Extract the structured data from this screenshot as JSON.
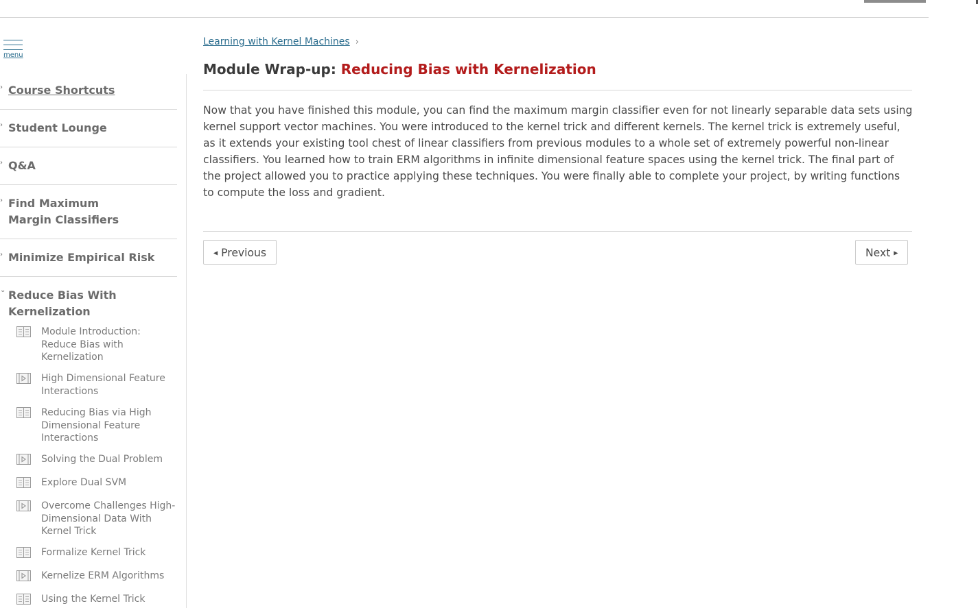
{
  "menu": {
    "label": "menu"
  },
  "sidebar": {
    "items": [
      {
        "label": "Course Shortcuts",
        "chevron": "›"
      },
      {
        "label": "Student Lounge",
        "chevron": "›"
      },
      {
        "label": "Q&A",
        "chevron": "›"
      },
      {
        "label": "Find Maximum Margin Classifiers",
        "chevron": "›"
      },
      {
        "label": "Minimize Empirical Risk",
        "chevron": "›"
      },
      {
        "label": "Reduce Bias With Kernelization",
        "chevron": "⌄"
      }
    ],
    "subitems": [
      {
        "label": "Module Introduction: Reduce Bias with Kernelization",
        "icon": "page-icon"
      },
      {
        "label": "High Dimensional Feature Interactions",
        "icon": "video-icon"
      },
      {
        "label": "Reducing Bias via High Dimensional Feature Interactions",
        "icon": "page-icon"
      },
      {
        "label": "Solving the Dual Problem",
        "icon": "video-icon"
      },
      {
        "label": "Explore Dual SVM",
        "icon": "page-icon"
      },
      {
        "label": "Overcome Challenges High-Dimensional Data With Kernel Trick",
        "icon": "video-icon"
      },
      {
        "label": "Formalize Kernel Trick",
        "icon": "page-icon"
      },
      {
        "label": "Kernelize ERM Algorithms",
        "icon": "video-icon"
      },
      {
        "label": "Using the Kernel Trick",
        "icon": "page-icon"
      }
    ]
  },
  "breadcrumb": {
    "link": "Learning with Kernel Machines",
    "separator": "›"
  },
  "page": {
    "title_prefix": "Module Wrap-up: ",
    "title_accent": "Reducing Bias with Kernelization",
    "body": "Now that you have finished this module, you can find the maximum margin classifier even for not linearly separable data sets using kernel support vector machines. You were introduced to the kernel trick and different kernels. The kernel trick is extremely useful, as it extends your existing tool chest of linear classifiers from previous modules to a whole set of extremely powerful non-linear classifiers. You learned how to train ERM algorithms in infinite dimensional feature spaces using the kernel trick. The final part of the project allowed you to practice applying these techniques. You were finally able to complete your project, by writing functions to compute the loss and gradient."
  },
  "nav": {
    "previous": "Previous",
    "next": "Next"
  },
  "colors": {
    "accent": "#b31b1b",
    "link": "#2b6d8e"
  }
}
